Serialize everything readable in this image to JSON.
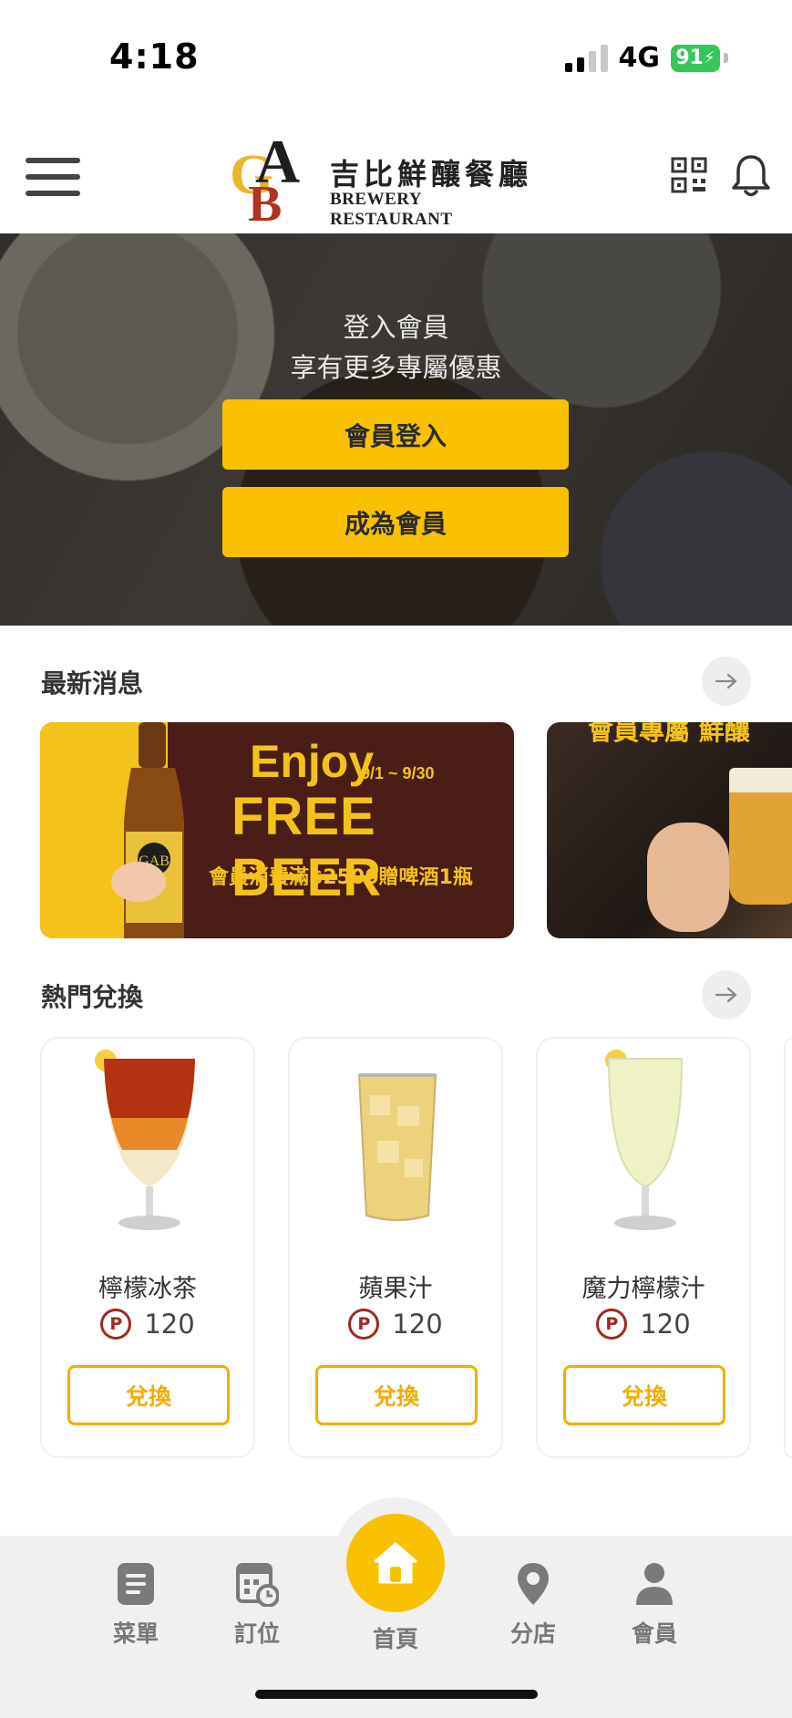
{
  "status_bar": {
    "time": "4:18",
    "network": "4G",
    "battery": "91"
  },
  "header": {
    "logo_mark": "GAB",
    "logo_cn": "吉比鮮釀餐廳",
    "logo_en": "BREWERY RESTAURANT"
  },
  "hero": {
    "line1": "登入會員",
    "line2": "享有更多專屬優惠",
    "login_label": "會員登入",
    "join_label": "成為會員"
  },
  "news": {
    "title": "最新消息",
    "banners": [
      {
        "enjoy": "Enjoy",
        "date": "9/1 ~ 9/30",
        "headline": "FREE BEER",
        "promo": "會員消費滿$2500贈啤酒1瓶"
      },
      {
        "text": "會員專屬 鮮釀"
      }
    ]
  },
  "rewards": {
    "title": "熱門兌換",
    "items": [
      {
        "name": "檸檬冰茶",
        "points": "120",
        "button": "兌換"
      },
      {
        "name": "蘋果汁",
        "points": "120",
        "button": "兌換"
      },
      {
        "name": "魔力檸檬汁",
        "points": "120",
        "button": "兌換"
      }
    ],
    "point_symbol": "P"
  },
  "bottom_nav": {
    "menu": "菜單",
    "booking": "訂位",
    "home": "首頁",
    "stores": "分店",
    "member": "會員"
  },
  "colors": {
    "accent": "#f9c100",
    "button_outline": "#f2ad00",
    "points": "#a3281e",
    "banner_bg": "#4a1d16"
  }
}
